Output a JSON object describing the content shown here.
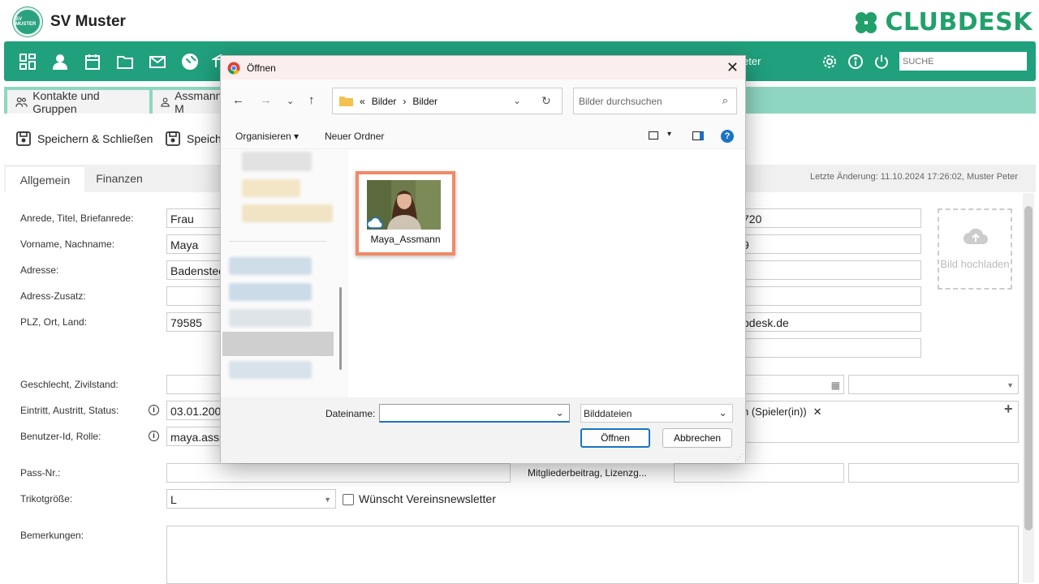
{
  "app": {
    "name": "SV Muster",
    "logo_text": "SV MUSTER",
    "brand": "CLUBDESK",
    "brand_color": "#22a06b"
  },
  "nav": {
    "user": "eter",
    "search_placeholder": "SUCHE"
  },
  "tabs": [
    {
      "label": "Kontakte und Gruppen"
    },
    {
      "label": "Assmann M"
    }
  ],
  "toolbar": {
    "save_close": "Speichern & Schließen",
    "save": "Speiche"
  },
  "form_tabs": [
    "Allgemein",
    "Finanzen"
  ],
  "last_change": "Letzte Änderung: 11.10.2024 17:26:02, Muster Peter",
  "form": {
    "labels": {
      "anrede": "Anrede, Titel, Briefanrede:",
      "name": "Vorname, Nachname:",
      "adresse": "Adresse:",
      "zusatz": "Adress-Zusatz:",
      "plz": "PLZ, Ort, Land:",
      "geschlecht": "Geschlecht, Zivilstand:",
      "eintritt": "Eintritt, Austritt, Status:",
      "benutzer": "Benutzer-Id, Rolle:",
      "pass": "Pass-Nr.:",
      "trikot": "Trikotgröße:",
      "bemerkungen": "Bemerkungen:",
      "beitrag": "Mitgliederbeitrag, Lizenzg..."
    },
    "values": {
      "anrede": "Frau",
      "vorname": "Maya",
      "adresse": "Badenstec",
      "plz": "79585",
      "eintritt": "03.01.2001",
      "benutzer": "maya.assm",
      "phone": "720",
      "phone2": "9",
      "email": "bdesk.de",
      "role": "n (Spieler(in))",
      "trikot": "L"
    },
    "newsletter": "Wünscht Vereinsnewsletter",
    "upload": "Bild hochladen"
  },
  "dialog": {
    "title": "Öffnen",
    "path": [
      "Bilder",
      "Bilder"
    ],
    "path_prefix": "«",
    "search_placeholder": "Bilder durchsuchen",
    "organize": "Organisieren",
    "new_folder": "Neuer Ordner",
    "file": {
      "name": "Maya_Assmann"
    },
    "filename_label": "Dateiname:",
    "filetype": "Bilddateien",
    "open": "Öffnen",
    "cancel": "Abbrechen"
  }
}
